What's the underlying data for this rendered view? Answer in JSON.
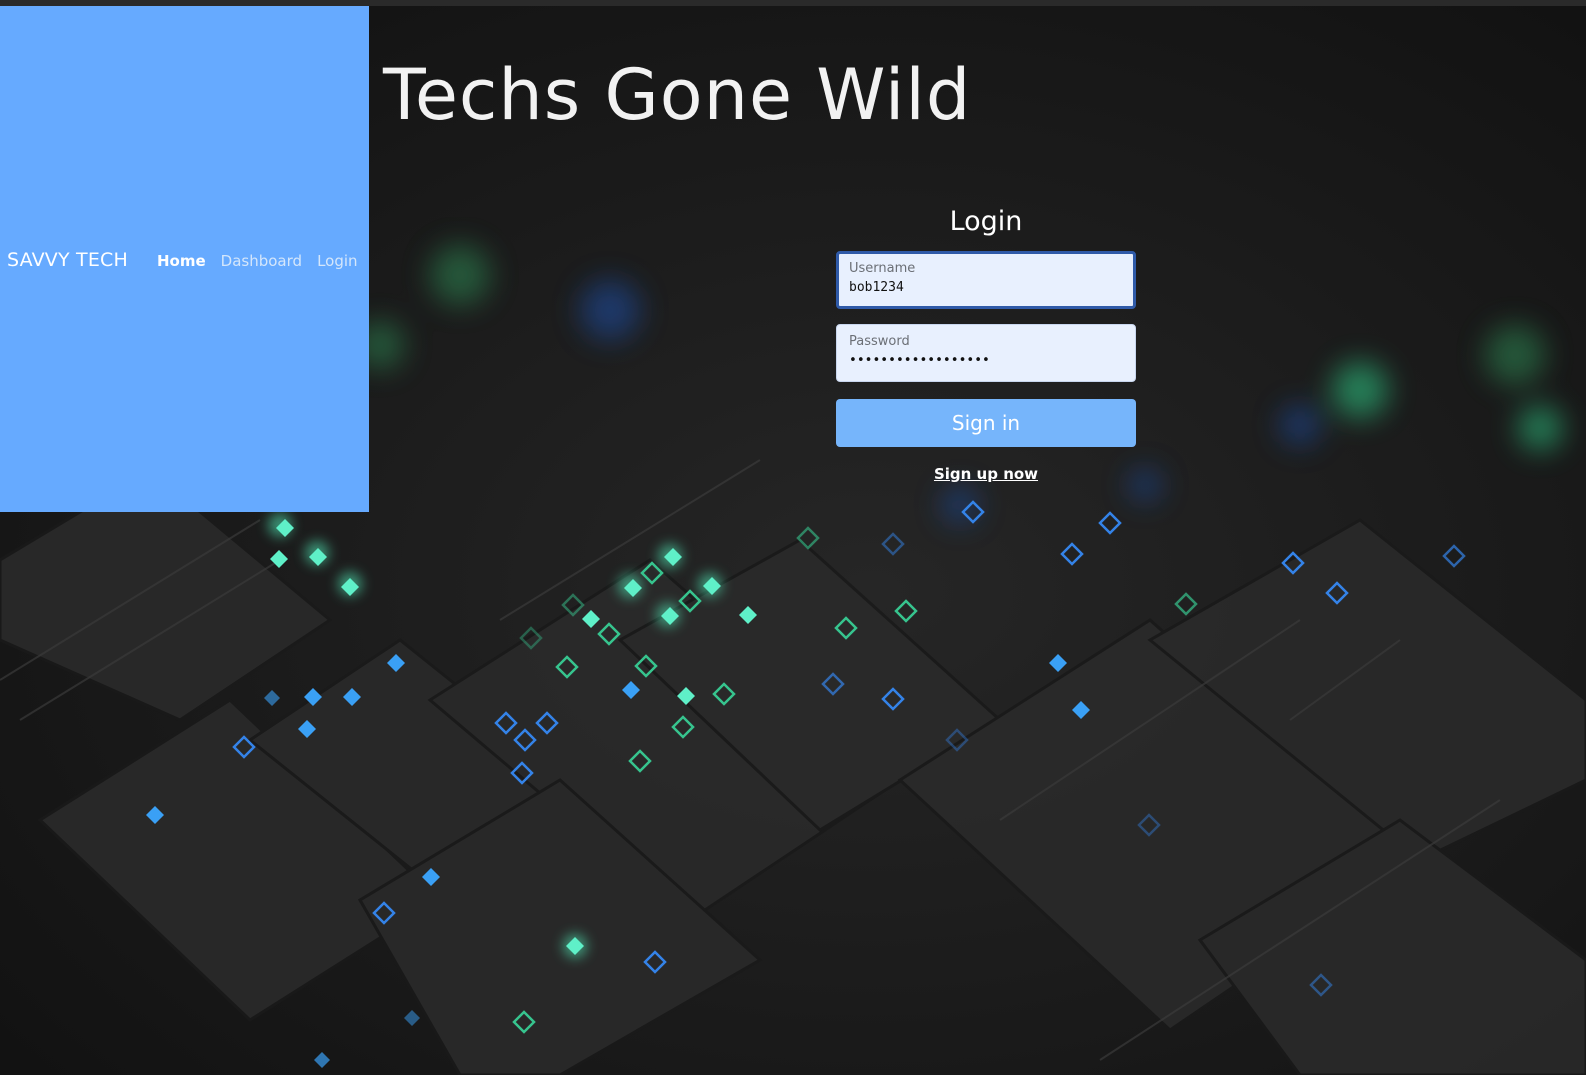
{
  "brand": "SAVVY TECH",
  "nav": {
    "home": "Home",
    "dashboard": "Dashboard",
    "login": "Login"
  },
  "site_title": "Techs Gone Wild",
  "login": {
    "heading": "Login",
    "username_label": "Username",
    "username_value": "bob1234",
    "password_label": "Password",
    "password_value": "••••••••••••••••••",
    "signin_label": "Sign in",
    "signup_label": "Sign up now"
  },
  "colors": {
    "nav_bg": "#66aaff",
    "button_bg": "#76b5fb",
    "field_bg": "#e8f0fe"
  },
  "background": "dark-circuit-pattern"
}
